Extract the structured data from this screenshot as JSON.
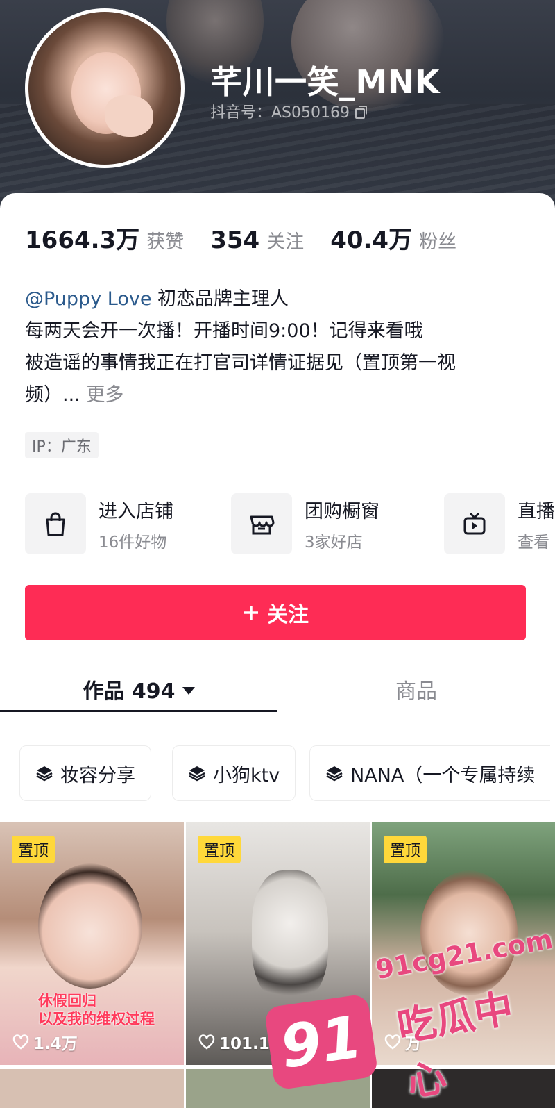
{
  "profile": {
    "username": "芊川一笑_MNK",
    "douyin_id": "抖音号：AS050169"
  },
  "stats": [
    {
      "value": "1664.3万",
      "label": "获赞"
    },
    {
      "value": "354",
      "label": "关注"
    },
    {
      "value": "40.4万",
      "label": "粉丝"
    }
  ],
  "bio": {
    "mention": "@Puppy Love",
    "mention_suffix": " 初恋品牌主理人",
    "line2": " 每两天会开一次播！开播时间9:00！记得来看哦",
    "line3": "被造谣的事情我正在打官司详情证据见（置顶第一视",
    "line4": "频）...",
    "more": " 更多"
  },
  "ip": "IP：广东",
  "shops": [
    {
      "title": "进入店铺",
      "subtitle": "16件好物",
      "icon": "shopping-bag-icon"
    },
    {
      "title": "团购橱窗",
      "subtitle": "3家好店",
      "icon": "store-icon"
    },
    {
      "title": "直播",
      "subtitle": "查看",
      "icon": "tv-icon"
    }
  ],
  "follow_button": "关注",
  "tabs": {
    "works": "作品 494",
    "products": "商品"
  },
  "collections": [
    {
      "label": "妆容分享"
    },
    {
      "label": "小狗ktv"
    },
    {
      "label": "NANA（一个专属持续"
    }
  ],
  "videos": [
    {
      "badge": "置顶",
      "likes": "1.4万",
      "overlay": "休假回归\n以及我的维权过程"
    },
    {
      "badge": "置顶",
      "likes": "101.1万"
    },
    {
      "badge": "置顶",
      "likes": "万"
    }
  ],
  "watermark": {
    "logo": "91",
    "site": "91cg21.com",
    "name": "吃瓜中心"
  },
  "colors": {
    "accent": "#fe2c55",
    "pin_badge": "#ffd83a",
    "mention": "#2b5a8c",
    "watermark": "#e8487f"
  }
}
